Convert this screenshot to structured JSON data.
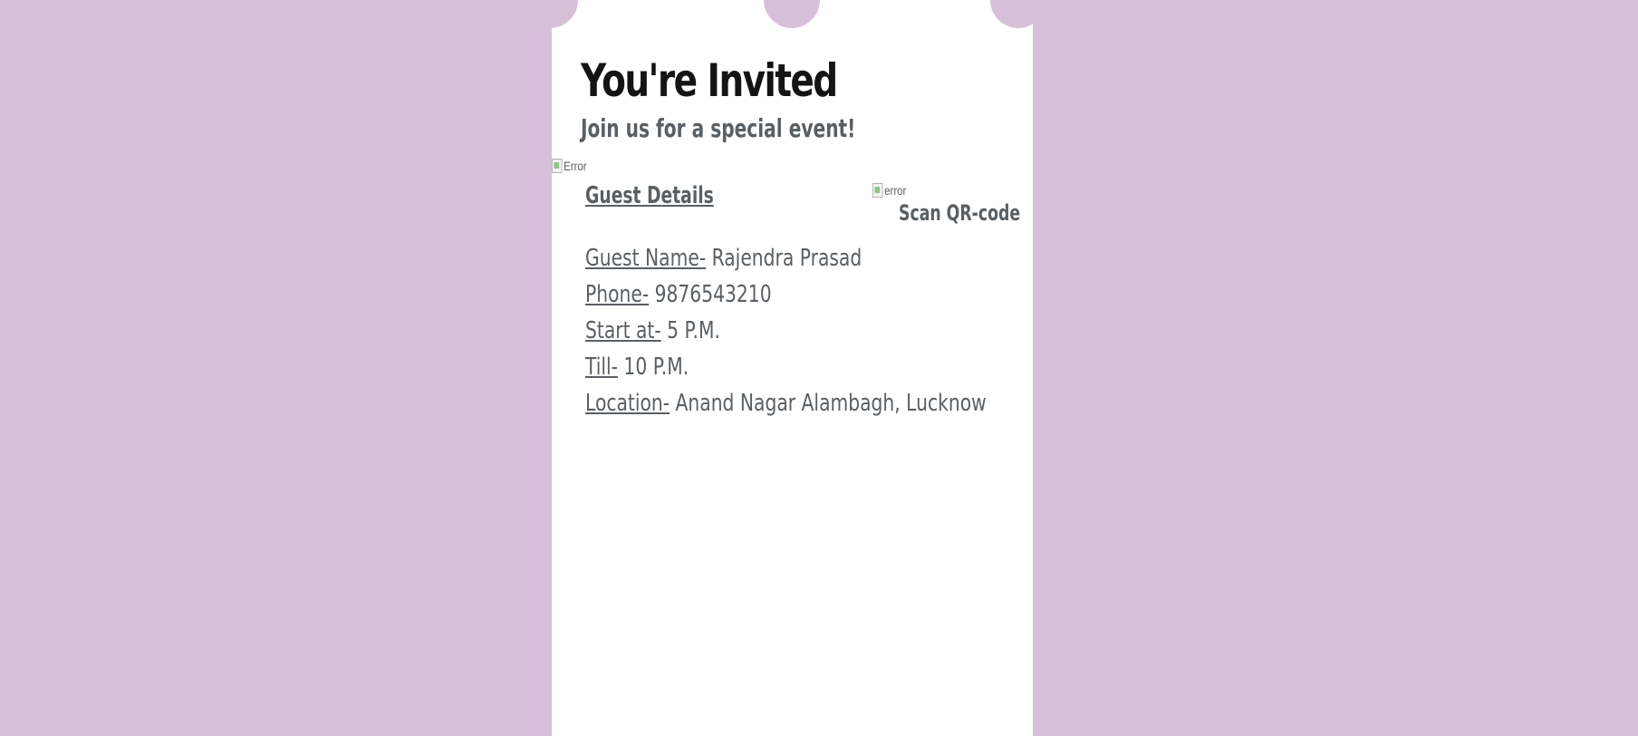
{
  "header": {
    "title": "You're Invited",
    "subtitle": "Join us for a special event!"
  },
  "images": {
    "banner_alt": "Error",
    "qr_alt": "error"
  },
  "guest_section": {
    "heading": "Guest Details",
    "qr_caption": "Scan QR-code"
  },
  "details": [
    {
      "label": "Guest Name-",
      "value": " Rajendra Prasad"
    },
    {
      "label": "Phone-",
      "value": " 9876543210"
    },
    {
      "label": "Start at-",
      "value": " 5 P.M."
    },
    {
      "label": "Till-",
      "value": " 10 P.M."
    },
    {
      "label": "Location-",
      "value": " Anand Nagar Alambagh, Lucknow"
    }
  ],
  "colors": {
    "background": "#d7bfd9",
    "card": "#ffffff",
    "title_text": "#141414",
    "body_text": "#5a5f63"
  }
}
